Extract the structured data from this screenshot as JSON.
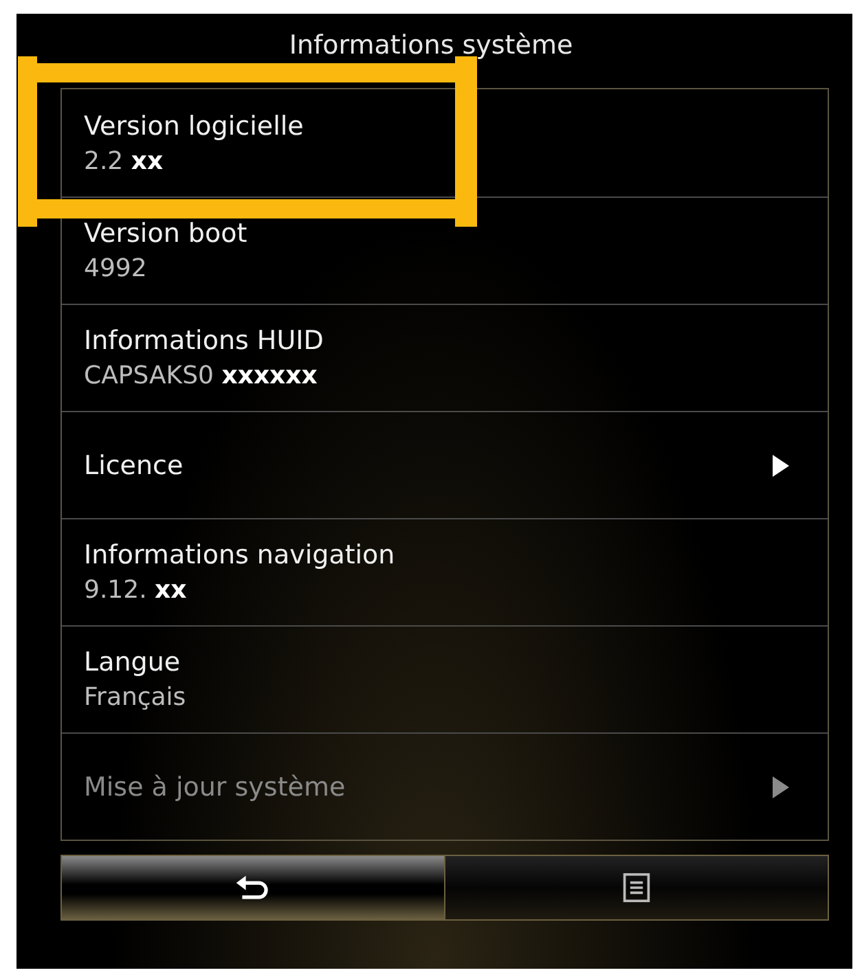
{
  "title": "Informations système",
  "rows": [
    {
      "kind": "info",
      "label": "Version logicielle",
      "value": "2.2 **xx**",
      "highlighted": true
    },
    {
      "kind": "info",
      "label": "Version boot",
      "value": "4992",
      "highlighted": false
    },
    {
      "kind": "info",
      "label": "Informations HUID",
      "value": "CAPSAKS0 **xxxxxx**",
      "highlighted": false
    },
    {
      "kind": "link",
      "label": "Licence",
      "disabled": false,
      "highlighted": false
    },
    {
      "kind": "info",
      "label": "Informations navigation",
      "value": "9.12. **xx**",
      "highlighted": false
    },
    {
      "kind": "info",
      "label": "Langue",
      "value": "Français",
      "highlighted": false
    },
    {
      "kind": "link",
      "label": "Mise à jour système",
      "disabled": true,
      "highlighted": false
    }
  ],
  "buttons": [
    {
      "kind": "back",
      "selected": true
    },
    {
      "kind": "list",
      "selected": false
    }
  ]
}
